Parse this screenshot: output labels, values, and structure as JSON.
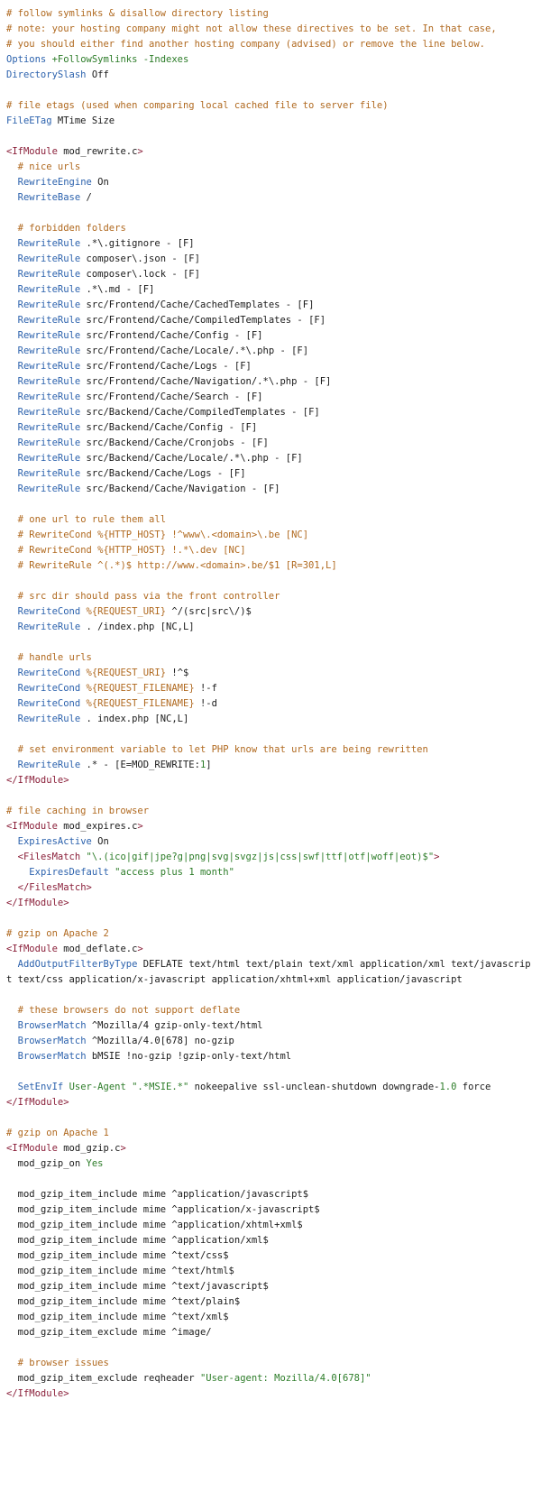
{
  "code": {
    "lines": [
      [
        {
          "t": "comment",
          "v": "# follow symlinks & disallow directory listing"
        }
      ],
      [
        {
          "t": "comment",
          "v": "# note: your hosting company might not allow these directives to be set. In that case,"
        }
      ],
      [
        {
          "t": "comment",
          "v": "# you should either find another hosting company (advised) or remove the line below."
        }
      ],
      [
        {
          "t": "directive",
          "v": "Options"
        },
        {
          "t": "plain",
          "v": " "
        },
        {
          "t": "value",
          "v": "+FollowSymlinks -Indexes"
        }
      ],
      [
        {
          "t": "directive",
          "v": "DirectorySlash"
        },
        {
          "t": "plain",
          "v": " Off"
        }
      ],
      [],
      [
        {
          "t": "comment",
          "v": "# file etags (used when comparing local cached file to server file)"
        }
      ],
      [
        {
          "t": "directive",
          "v": "FileETag"
        },
        {
          "t": "plain",
          "v": " MTime Size"
        }
      ],
      [],
      [
        {
          "t": "tag",
          "v": "<IfModule"
        },
        {
          "t": "plain",
          "v": " mod_rewrite.c"
        },
        {
          "t": "tag",
          "v": ">"
        }
      ],
      [
        {
          "t": "plain",
          "v": "  "
        },
        {
          "t": "comment",
          "v": "# nice urls"
        }
      ],
      [
        {
          "t": "plain",
          "v": "  "
        },
        {
          "t": "directive",
          "v": "RewriteEngine"
        },
        {
          "t": "plain",
          "v": " On"
        }
      ],
      [
        {
          "t": "plain",
          "v": "  "
        },
        {
          "t": "directive",
          "v": "RewriteBase"
        },
        {
          "t": "plain",
          "v": " /"
        }
      ],
      [],
      [
        {
          "t": "plain",
          "v": "  "
        },
        {
          "t": "comment",
          "v": "# forbidden folders"
        }
      ],
      [
        {
          "t": "plain",
          "v": "  "
        },
        {
          "t": "directive",
          "v": "RewriteRule"
        },
        {
          "t": "plain",
          "v": " .*\\.gitignore - [F]"
        }
      ],
      [
        {
          "t": "plain",
          "v": "  "
        },
        {
          "t": "directive",
          "v": "RewriteRule"
        },
        {
          "t": "plain",
          "v": " composer\\.json - [F]"
        }
      ],
      [
        {
          "t": "plain",
          "v": "  "
        },
        {
          "t": "directive",
          "v": "RewriteRule"
        },
        {
          "t": "plain",
          "v": " composer\\.lock - [F]"
        }
      ],
      [
        {
          "t": "plain",
          "v": "  "
        },
        {
          "t": "directive",
          "v": "RewriteRule"
        },
        {
          "t": "plain",
          "v": " .*\\.md - [F]"
        }
      ],
      [
        {
          "t": "plain",
          "v": "  "
        },
        {
          "t": "directive",
          "v": "RewriteRule"
        },
        {
          "t": "plain",
          "v": " src/Frontend/Cache/CachedTemplates - [F]"
        }
      ],
      [
        {
          "t": "plain",
          "v": "  "
        },
        {
          "t": "directive",
          "v": "RewriteRule"
        },
        {
          "t": "plain",
          "v": " src/Frontend/Cache/CompiledTemplates - [F]"
        }
      ],
      [
        {
          "t": "plain",
          "v": "  "
        },
        {
          "t": "directive",
          "v": "RewriteRule"
        },
        {
          "t": "plain",
          "v": " src/Frontend/Cache/Config - [F]"
        }
      ],
      [
        {
          "t": "plain",
          "v": "  "
        },
        {
          "t": "directive",
          "v": "RewriteRule"
        },
        {
          "t": "plain",
          "v": " src/Frontend/Cache/Locale/.*\\.php - [F]"
        }
      ],
      [
        {
          "t": "plain",
          "v": "  "
        },
        {
          "t": "directive",
          "v": "RewriteRule"
        },
        {
          "t": "plain",
          "v": " src/Frontend/Cache/Logs - [F]"
        }
      ],
      [
        {
          "t": "plain",
          "v": "  "
        },
        {
          "t": "directive",
          "v": "RewriteRule"
        },
        {
          "t": "plain",
          "v": " src/Frontend/Cache/Navigation/.*\\.php - [F]"
        }
      ],
      [
        {
          "t": "plain",
          "v": "  "
        },
        {
          "t": "directive",
          "v": "RewriteRule"
        },
        {
          "t": "plain",
          "v": " src/Frontend/Cache/Search - [F]"
        }
      ],
      [
        {
          "t": "plain",
          "v": "  "
        },
        {
          "t": "directive",
          "v": "RewriteRule"
        },
        {
          "t": "plain",
          "v": " src/Backend/Cache/CompiledTemplates - [F]"
        }
      ],
      [
        {
          "t": "plain",
          "v": "  "
        },
        {
          "t": "directive",
          "v": "RewriteRule"
        },
        {
          "t": "plain",
          "v": " src/Backend/Cache/Config - [F]"
        }
      ],
      [
        {
          "t": "plain",
          "v": "  "
        },
        {
          "t": "directive",
          "v": "RewriteRule"
        },
        {
          "t": "plain",
          "v": " src/Backend/Cache/Cronjobs - [F]"
        }
      ],
      [
        {
          "t": "plain",
          "v": "  "
        },
        {
          "t": "directive",
          "v": "RewriteRule"
        },
        {
          "t": "plain",
          "v": " src/Backend/Cache/Locale/.*\\.php - [F]"
        }
      ],
      [
        {
          "t": "plain",
          "v": "  "
        },
        {
          "t": "directive",
          "v": "RewriteRule"
        },
        {
          "t": "plain",
          "v": " src/Backend/Cache/Logs - [F]"
        }
      ],
      [
        {
          "t": "plain",
          "v": "  "
        },
        {
          "t": "directive",
          "v": "RewriteRule"
        },
        {
          "t": "plain",
          "v": " src/Backend/Cache/Navigation - [F]"
        }
      ],
      [],
      [
        {
          "t": "plain",
          "v": "  "
        },
        {
          "t": "comment",
          "v": "# one url to rule them all"
        }
      ],
      [
        {
          "t": "plain",
          "v": "  "
        },
        {
          "t": "comment",
          "v": "# RewriteCond %{HTTP_HOST} !^www\\.<domain>\\.be [NC]"
        }
      ],
      [
        {
          "t": "plain",
          "v": "  "
        },
        {
          "t": "comment",
          "v": "# RewriteCond %{HTTP_HOST} !.*\\.dev [NC]"
        }
      ],
      [
        {
          "t": "plain",
          "v": "  "
        },
        {
          "t": "comment",
          "v": "# RewriteRule ^(.*)$ http://www.<domain>.be/$1 [R=301,L]"
        }
      ],
      [],
      [
        {
          "t": "plain",
          "v": "  "
        },
        {
          "t": "comment",
          "v": "# src dir should pass via the front controller"
        }
      ],
      [
        {
          "t": "plain",
          "v": "  "
        },
        {
          "t": "directive",
          "v": "RewriteCond"
        },
        {
          "t": "plain",
          "v": " "
        },
        {
          "t": "env",
          "v": "%{REQUEST_URI}"
        },
        {
          "t": "plain",
          "v": " ^/(src|src\\/)$"
        }
      ],
      [
        {
          "t": "plain",
          "v": "  "
        },
        {
          "t": "directive",
          "v": "RewriteRule"
        },
        {
          "t": "plain",
          "v": " . /index.php [NC,L]"
        }
      ],
      [],
      [
        {
          "t": "plain",
          "v": "  "
        },
        {
          "t": "comment",
          "v": "# handle urls"
        }
      ],
      [
        {
          "t": "plain",
          "v": "  "
        },
        {
          "t": "directive",
          "v": "RewriteCond"
        },
        {
          "t": "plain",
          "v": " "
        },
        {
          "t": "env",
          "v": "%{REQUEST_URI}"
        },
        {
          "t": "plain",
          "v": " !^$"
        }
      ],
      [
        {
          "t": "plain",
          "v": "  "
        },
        {
          "t": "directive",
          "v": "RewriteCond"
        },
        {
          "t": "plain",
          "v": " "
        },
        {
          "t": "env",
          "v": "%{REQUEST_FILENAME}"
        },
        {
          "t": "plain",
          "v": " !-f"
        }
      ],
      [
        {
          "t": "plain",
          "v": "  "
        },
        {
          "t": "directive",
          "v": "RewriteCond"
        },
        {
          "t": "plain",
          "v": " "
        },
        {
          "t": "env",
          "v": "%{REQUEST_FILENAME}"
        },
        {
          "t": "plain",
          "v": " !-d"
        }
      ],
      [
        {
          "t": "plain",
          "v": "  "
        },
        {
          "t": "directive",
          "v": "RewriteRule"
        },
        {
          "t": "plain",
          "v": " . index.php [NC,L]"
        }
      ],
      [],
      [
        {
          "t": "plain",
          "v": "  "
        },
        {
          "t": "comment",
          "v": "# set environment variable to let PHP know that urls are being rewritten"
        }
      ],
      [
        {
          "t": "plain",
          "v": "  "
        },
        {
          "t": "directive",
          "v": "RewriteRule"
        },
        {
          "t": "plain",
          "v": " .* - [E=MOD_REWRITE:"
        },
        {
          "t": "value",
          "v": "1"
        },
        {
          "t": "plain",
          "v": "]"
        }
      ],
      [
        {
          "t": "tag",
          "v": "</IfModule>"
        }
      ],
      [],
      [
        {
          "t": "comment",
          "v": "# file caching in browser"
        }
      ],
      [
        {
          "t": "tag",
          "v": "<IfModule"
        },
        {
          "t": "plain",
          "v": " mod_expires.c"
        },
        {
          "t": "tag",
          "v": ">"
        }
      ],
      [
        {
          "t": "plain",
          "v": "  "
        },
        {
          "t": "directive",
          "v": "ExpiresActive"
        },
        {
          "t": "plain",
          "v": " On"
        }
      ],
      [
        {
          "t": "plain",
          "v": "  "
        },
        {
          "t": "tag",
          "v": "<FilesMatch"
        },
        {
          "t": "plain",
          "v": " "
        },
        {
          "t": "string",
          "v": "\"\\.(ico|gif|jpe?g|png|svg|svgz|js|css|swf|ttf|otf|woff|eot)$\""
        },
        {
          "t": "tag",
          "v": ">"
        }
      ],
      [
        {
          "t": "plain",
          "v": "    "
        },
        {
          "t": "directive",
          "v": "ExpiresDefault"
        },
        {
          "t": "plain",
          "v": " "
        },
        {
          "t": "string",
          "v": "\"access plus 1 month\""
        }
      ],
      [
        {
          "t": "plain",
          "v": "  "
        },
        {
          "t": "tag",
          "v": "</FilesMatch>"
        }
      ],
      [
        {
          "t": "tag",
          "v": "</IfModule>"
        }
      ],
      [],
      [
        {
          "t": "comment",
          "v": "# gzip on Apache 2"
        }
      ],
      [
        {
          "t": "tag",
          "v": "<IfModule"
        },
        {
          "t": "plain",
          "v": " mod_deflate.c"
        },
        {
          "t": "tag",
          "v": ">"
        }
      ],
      [
        {
          "t": "plain",
          "v": "  "
        },
        {
          "t": "directive",
          "v": "AddOutputFilterByType"
        },
        {
          "t": "plain",
          "v": " DEFLATE text/html text/plain text/xml application/xml text/javascript text/css application/x-javascript application/xhtml+xml application/javascript"
        }
      ],
      [],
      [
        {
          "t": "plain",
          "v": "  "
        },
        {
          "t": "comment",
          "v": "# these browsers do not support deflate"
        }
      ],
      [
        {
          "t": "plain",
          "v": "  "
        },
        {
          "t": "directive",
          "v": "BrowserMatch"
        },
        {
          "t": "plain",
          "v": " ^Mozilla/4 gzip-only-text/html"
        }
      ],
      [
        {
          "t": "plain",
          "v": "  "
        },
        {
          "t": "directive",
          "v": "BrowserMatch"
        },
        {
          "t": "plain",
          "v": " ^Mozilla/4.0[678] no-gzip"
        }
      ],
      [
        {
          "t": "plain",
          "v": "  "
        },
        {
          "t": "directive",
          "v": "BrowserMatch"
        },
        {
          "t": "plain",
          "v": " bMSIE !no-gzip !gzip-only-text/html"
        }
      ],
      [],
      [
        {
          "t": "plain",
          "v": "  "
        },
        {
          "t": "directive",
          "v": "SetEnvIf"
        },
        {
          "t": "plain",
          "v": " "
        },
        {
          "t": "value",
          "v": "User-Agent"
        },
        {
          "t": "plain",
          "v": " "
        },
        {
          "t": "string",
          "v": "\".*MSIE.*\""
        },
        {
          "t": "plain",
          "v": " nokeepalive ssl-unclean-shutdown downgrade-"
        },
        {
          "t": "value",
          "v": "1.0"
        },
        {
          "t": "plain",
          "v": " force"
        }
      ],
      [
        {
          "t": "tag",
          "v": "</IfModule>"
        }
      ],
      [],
      [
        {
          "t": "comment",
          "v": "# gzip on Apache 1"
        }
      ],
      [
        {
          "t": "tag",
          "v": "<IfModule"
        },
        {
          "t": "plain",
          "v": " mod_gzip.c"
        },
        {
          "t": "tag",
          "v": ">"
        }
      ],
      [
        {
          "t": "plain",
          "v": "  mod_gzip_on "
        },
        {
          "t": "value",
          "v": "Yes"
        }
      ],
      [],
      [
        {
          "t": "plain",
          "v": "  mod_gzip_item_include mime ^application/javascript$"
        }
      ],
      [
        {
          "t": "plain",
          "v": "  mod_gzip_item_include mime ^application/x-javascript$"
        }
      ],
      [
        {
          "t": "plain",
          "v": "  mod_gzip_item_include mime ^application/xhtml+xml$"
        }
      ],
      [
        {
          "t": "plain",
          "v": "  mod_gzip_item_include mime ^application/xml$"
        }
      ],
      [
        {
          "t": "plain",
          "v": "  mod_gzip_item_include mime ^text/css$"
        }
      ],
      [
        {
          "t": "plain",
          "v": "  mod_gzip_item_include mime ^text/html$"
        }
      ],
      [
        {
          "t": "plain",
          "v": "  mod_gzip_item_include mime ^text/javascript$"
        }
      ],
      [
        {
          "t": "plain",
          "v": "  mod_gzip_item_include mime ^text/plain$"
        }
      ],
      [
        {
          "t": "plain",
          "v": "  mod_gzip_item_include mime ^text/xml$"
        }
      ],
      [
        {
          "t": "plain",
          "v": "  mod_gzip_item_exclude mime ^image/"
        }
      ],
      [],
      [
        {
          "t": "plain",
          "v": "  "
        },
        {
          "t": "comment",
          "v": "# browser issues"
        }
      ],
      [
        {
          "t": "plain",
          "v": "  mod_gzip_item_exclude reqheader "
        },
        {
          "t": "string",
          "v": "\"User-agent: Mozilla/4.0[678]\""
        }
      ],
      [
        {
          "t": "tag",
          "v": "</IfModule>"
        }
      ]
    ]
  },
  "colors": {
    "comment": "#b0691f",
    "directive": "#2c62ad",
    "tag": "#8a1f39",
    "value": "#2c7c28",
    "string": "#2c7c28",
    "text": "#1a1a1a",
    "background": "#ffffff"
  }
}
